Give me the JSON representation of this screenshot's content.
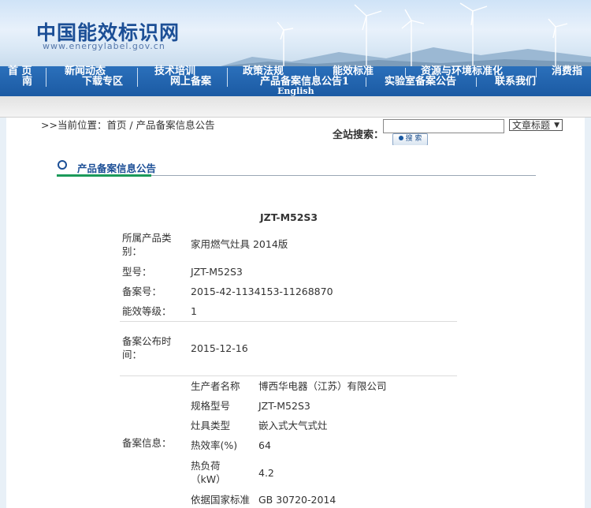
{
  "site": {
    "title": "中国能效标识网",
    "url": "www.energylabel.gov.cn"
  },
  "nav": {
    "row1": [
      "首 页",
      "新闻动态",
      "技术培训",
      "政策法规",
      "能效标准",
      "资源与环境标准化",
      "消费指"
    ],
    "row2": [
      "南",
      "下载专区",
      "网上备案",
      "产品备案信息公告1",
      "实验室备案公告",
      "联系我们"
    ],
    "row3": "English"
  },
  "breadcrumb": {
    "text": ">>当前位置：首页   /   产品备案信息公告"
  },
  "search": {
    "label": "全站搜索：",
    "value": "",
    "select": "文章标题",
    "button": "搜 索"
  },
  "section": {
    "title": "产品备案信息公告"
  },
  "product": {
    "title": "JZT-M52S3",
    "fields": [
      {
        "label": "所属产品类别：",
        "value": "家用燃气灶具 2014版"
      },
      {
        "label": "型号：",
        "value": "JZT-M52S3"
      },
      {
        "label": "备案号：",
        "value": "2015-42-1134153-11268870"
      },
      {
        "label": "能效等级：",
        "value": "1"
      },
      {
        "label": "备案公布时间：",
        "value": "2015-12-16"
      }
    ],
    "info_label": "备案信息：",
    "info": [
      {
        "label": "生产者名称",
        "value": "博西华电器（江苏）有限公司"
      },
      {
        "label": "规格型号",
        "value": "JZT-M52S3"
      },
      {
        "label": "灶具类型",
        "value": "嵌入式大气式灶"
      },
      {
        "label": "热效率(%)",
        "value": "64"
      },
      {
        "label": "热负荷（kW）",
        "value": "4.2"
      },
      {
        "label": "依据国家标准",
        "value": "GB 30720-2014"
      }
    ]
  },
  "colors": {
    "nav": "#1b5aa3",
    "title_blue": "#1c4f96",
    "accent_green": "#1c9a5a"
  }
}
